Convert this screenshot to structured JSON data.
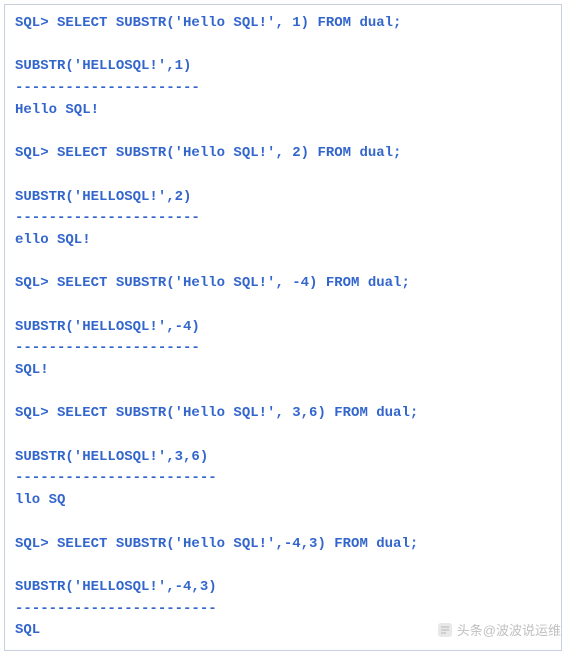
{
  "terminal": {
    "blocks": [
      {
        "prompt": "SQL> SELECT SUBSTR('Hello SQL!', 1) FROM dual;",
        "header": "SUBSTR('HELLOSQL!',1)",
        "divider": "----------------------",
        "result": "Hello SQL!"
      },
      {
        "prompt": "SQL> SELECT SUBSTR('Hello SQL!', 2) FROM dual;",
        "header": "SUBSTR('HELLOSQL!',2)",
        "divider": "----------------------",
        "result": "ello SQL!"
      },
      {
        "prompt": "SQL> SELECT SUBSTR('Hello SQL!', -4) FROM dual;",
        "header": "SUBSTR('HELLOSQL!',-4)",
        "divider": "----------------------",
        "result": "SQL!"
      },
      {
        "prompt": "SQL> SELECT SUBSTR('Hello SQL!', 3,6) FROM dual;",
        "header": "SUBSTR('HELLOSQL!',3,6)",
        "divider": "------------------------",
        "result": "llo SQ"
      },
      {
        "prompt": "SQL> SELECT SUBSTR('Hello SQL!',-4,3) FROM dual;",
        "header": "SUBSTR('HELLOSQL!',-4,3)",
        "divider": "------------------------",
        "result": "SQL"
      }
    ]
  },
  "watermark": {
    "text": "头条@波波说运维"
  }
}
